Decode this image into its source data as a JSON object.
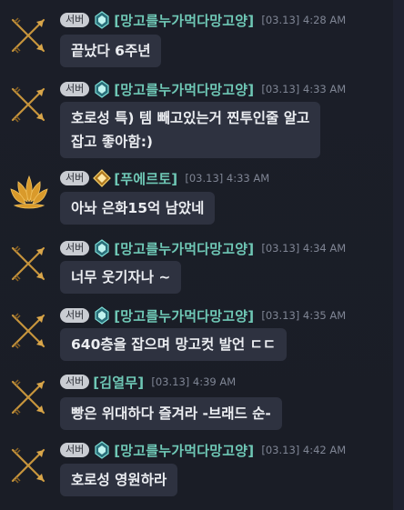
{
  "messages": [
    {
      "tag": "서버",
      "name": "[망고를누가먹다망고양]",
      "time": "[03.13] 4:28 AM",
      "text": "끝났다 6주년",
      "avatar": "arrows-emblem",
      "rank": "crystal"
    },
    {
      "tag": "서버",
      "name": "[망고를누가먹다망고양]",
      "time": "[03.13] 4:33 AM",
      "text_lines": [
        "호로성 특) 템 빼고있는거 찐투인줄 알고",
        "잡고 좋아함:)"
      ],
      "avatar": "arrows-emblem",
      "rank": "crystal"
    },
    {
      "tag": "서버",
      "name": "[푸에르토]",
      "time": "[03.13] 4:33 AM",
      "text": "아놔 은화15억 남았네",
      "avatar": "lotus-emblem",
      "rank": "gold-diamond"
    },
    {
      "tag": "서버",
      "name": "[망고를누가먹다망고양]",
      "time": "[03.13] 4:34 AM",
      "text": "너무 웃기자나 ~",
      "avatar": "arrows-emblem",
      "rank": "crystal"
    },
    {
      "tag": "서버",
      "name": "[망고를누가먹다망고양]",
      "time": "[03.13] 4:35 AM",
      "text": "640층을 잡으며 망고컷 발언 ㄷㄷ",
      "avatar": "arrows-emblem",
      "rank": "crystal"
    },
    {
      "tag": "서버",
      "name": "[김열무]",
      "time": "[03.13] 4:39 AM",
      "text": "빵은 위대하다 즐겨라 -브래드 순-",
      "avatar": "arrows-emblem",
      "rank": "none"
    },
    {
      "tag": "서버",
      "name": "[망고를누가먹다망고양]",
      "time": "[03.13] 4:42 AM",
      "text": "호로성 영원하라",
      "avatar": "arrows-emblem",
      "rank": "crystal"
    }
  ],
  "colors": {
    "background": "#1a1d26",
    "bubble": "#2e3240",
    "name": "#6fc8b6",
    "time": "#7f8594",
    "tag_bg": "#c9ccd2"
  }
}
